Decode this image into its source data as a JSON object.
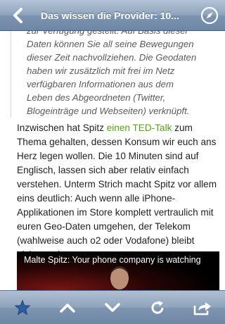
{
  "nav": {
    "back_label": "",
    "title": "Das wissen die Provider: 10...",
    "back_icon": "back-arrow-icon",
    "compass_icon": "compass-icon"
  },
  "article": {
    "quote_lines": [
      "zur Verfügung gestellt. Auf Basis dieser",
      "Daten können Sie all seine Bewegungen",
      "dieser Zeit nachvollziehen. Die Geodaten",
      "haben wir zusätzlich mit frei im Netz",
      "verfügbaren Informationen aus dem",
      "Leben des Abgeordneten (Twitter,",
      "Blogeinträge und Webseiten) verknüpft."
    ],
    "para_before_link": "Inzwischen hat Spitz ",
    "link_text": "einen TED-Talk",
    "para_after_link": " zum Thema gehalten, dessen Konsum wir euch ans Herz legen wollen. Die 10 Minuten sind auf Englisch, lassen sich aber relativ einfach verstehen. Unterm Strich macht Spitz vor allem eins deutlich: Auch wenn alle iPhone-Applikationen im Store komplett vertraulich mit euren Geo-Daten umgehen, der Telekom (wahlweise auch o2 oder Vodafone) bleibt nichts verborgen.",
    "video_title": "Malte Spitz: Your phone company is watching"
  },
  "toolbar": {
    "icons": [
      "star-icon",
      "arrow-up-icon",
      "arrow-down-icon",
      "refresh-icon",
      "share-icon"
    ]
  },
  "colors": {
    "link": "#5aa020",
    "nav_gradient_top": "#b4c3d5",
    "nav_gradient_bottom": "#6d86a5"
  }
}
